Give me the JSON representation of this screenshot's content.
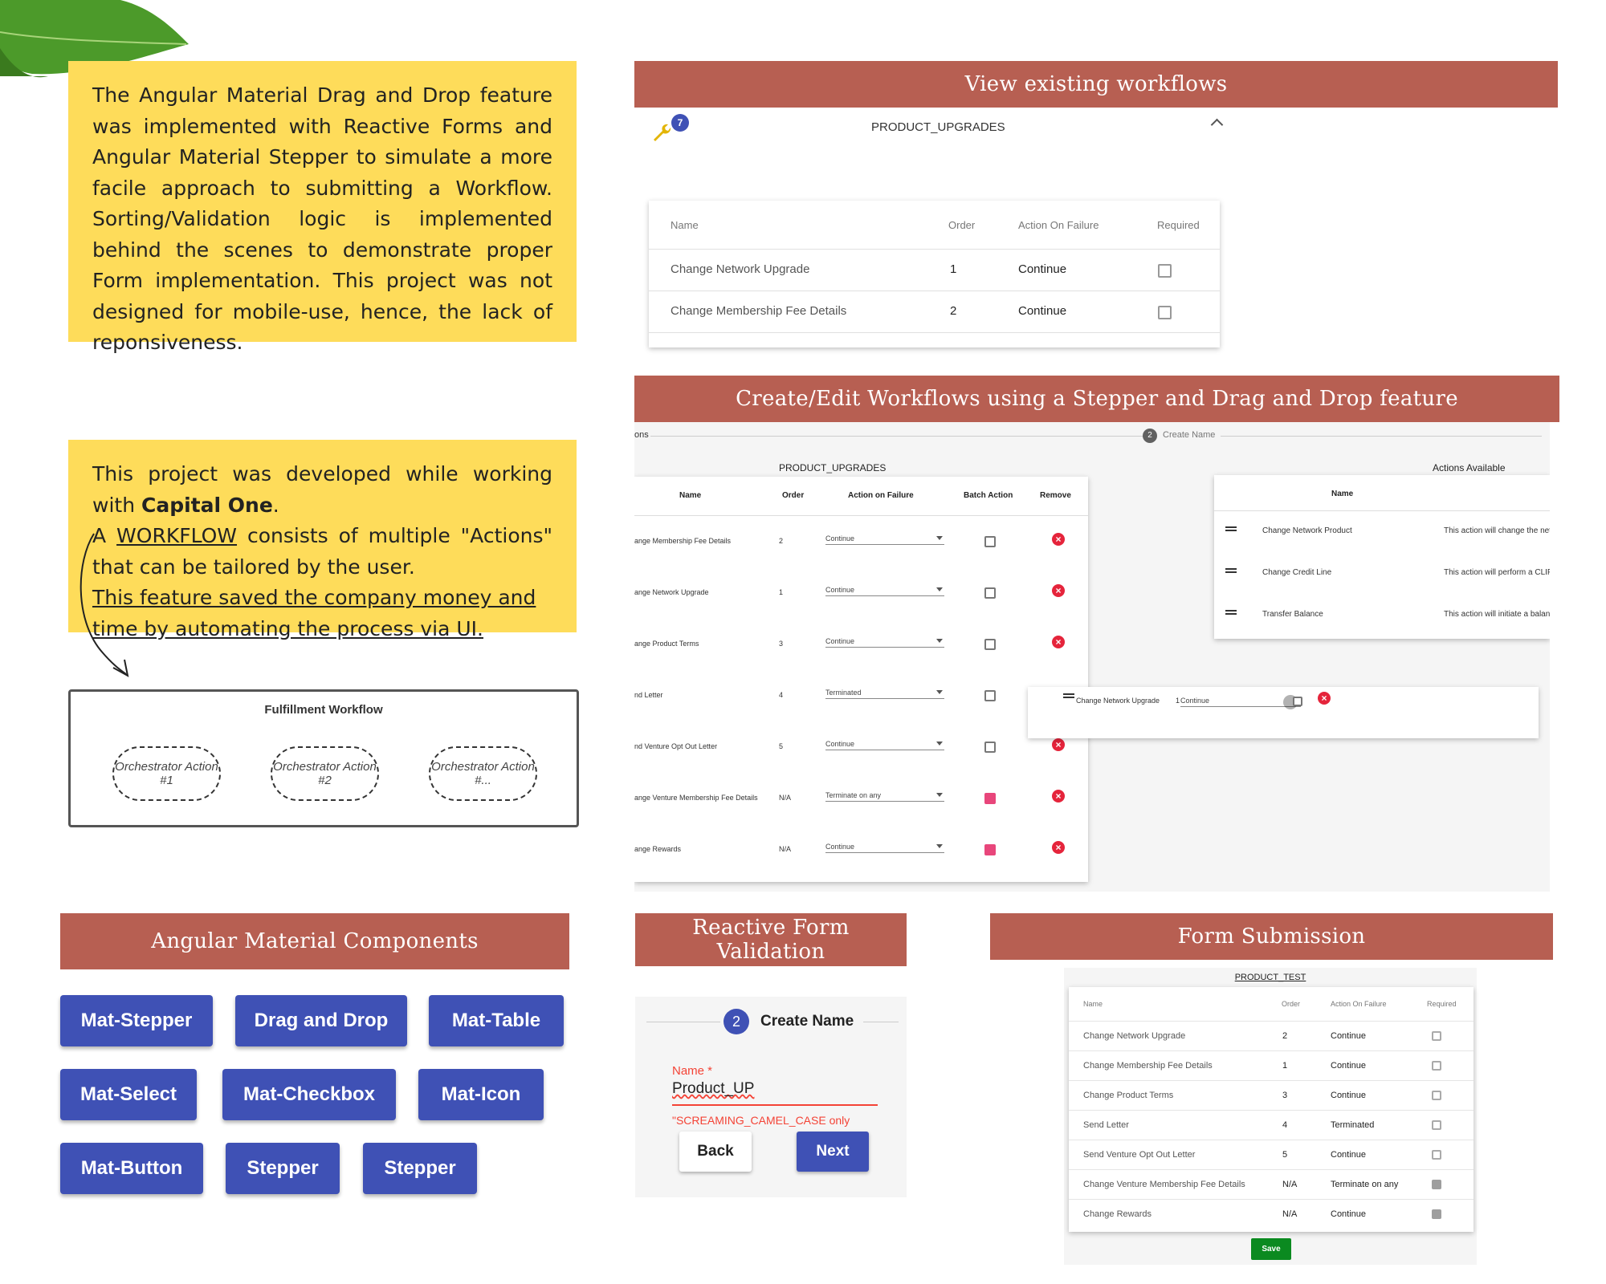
{
  "colors": {
    "note_yellow": "#fedc5a",
    "banner": "#b75f52",
    "material_indigo": "#3f51b5",
    "save_green": "#0b8a20",
    "error_red": "#f44336",
    "checkbox_pink": "#e8467b"
  },
  "notes": {
    "intro": "The Angular Material Drag and Drop feature was implemented with Reactive Forms and Angular Material Stepper to simulate a more facile approach to submitting a Workflow. Sorting/Validation logic is implemented behind the scenes to demonstrate proper Form implementation. This project was not designed for mobile-use, hence, the lack of reponsiveness.",
    "capital_prefix": "This project was developed while working with ",
    "capital_name": "Capital One",
    "capital_suffix": ".",
    "workflow_prefix": "A ",
    "workflow_word": "WORKFLOW",
    "workflow_suffix": " consists of multiple \"Actions\" that can be tailored by the user.",
    "saved": "This feature saved the company money and time by automating the process via UI. "
  },
  "fulfillment": {
    "title": "Fulfillment Workflow",
    "actions": [
      "Orchestrator Action #1",
      "Orchestrator Action #2",
      "Orchestrator Action #..."
    ]
  },
  "banners": {
    "view": "View existing workflows",
    "create": "Create/Edit Workflows using a Stepper and Drag and Drop feature",
    "components": "Angular Material Components",
    "validation": "Reactive Form Validation",
    "submission": "Form Submission"
  },
  "view_panel": {
    "badge": "7",
    "icon": "wrench-icon",
    "title": "PRODUCT_UPGRADES",
    "headers": [
      "Name",
      "Order",
      "Action On Failure",
      "Required"
    ],
    "rows": [
      {
        "name": "Change Network Upgrade",
        "order": "1",
        "action": "Continue"
      },
      {
        "name": "Change Membership Fee Details",
        "order": "2",
        "action": "Continue"
      }
    ]
  },
  "create_panel": {
    "step_fragment": "ons",
    "step_number": "2",
    "step_label": "Create Name",
    "workflow_title": "PRODUCT_UPGRADES",
    "available_title": "Actions Available",
    "headers": [
      "Name",
      "Order",
      "Action on Failure",
      "Batch Action",
      "Remove"
    ],
    "rows": [
      {
        "name": "ange Membership Fee Details",
        "order": "2",
        "action": "Continue",
        "batch": false
      },
      {
        "name": "ange Network Upgrade",
        "order": "1",
        "action": "Continue",
        "batch": false
      },
      {
        "name": "ange Product Terms",
        "order": "3",
        "action": "Continue",
        "batch": false
      },
      {
        "name": "nd Letter",
        "order": "4",
        "action": "Terminated",
        "batch": false
      },
      {
        "name": "nd Venture Opt Out Letter",
        "order": "5",
        "action": "Continue",
        "batch": false
      },
      {
        "name": "ange Venture Membership Fee Details",
        "order": "N/A",
        "action": "Terminate on any",
        "batch": true
      },
      {
        "name": "ange Rewards",
        "order": "N/A",
        "action": "Continue",
        "batch": true
      }
    ],
    "available_header": "Name",
    "available_rows": [
      {
        "name": "Change Network Product",
        "desc": "This action will change the net"
      },
      {
        "name": "Change Credit Line",
        "desc": "This action will perform a CLIP"
      },
      {
        "name": "Transfer Balance",
        "desc": "This action will initiate a balan"
      }
    ],
    "dragging": {
      "name": "Change Network Upgrade",
      "order": "1",
      "action": "Continue"
    }
  },
  "components": [
    "Mat-Stepper",
    "Drag and Drop",
    "Mat-Table",
    "Mat-Select",
    "Mat-Checkbox",
    "Mat-Icon",
    "Mat-Button",
    "Stepper",
    "Stepper"
  ],
  "validation_panel": {
    "step_number": "2",
    "step_label": "Create Name",
    "field_label": "Name *",
    "field_value": "Product_UP",
    "error": "\"SCREAMING_CAMEL_CASE only",
    "back": "Back",
    "next": "Next"
  },
  "submission_panel": {
    "title": "PRODUCT_TEST",
    "headers": [
      "Name",
      "Order",
      "Action On Failure",
      "Required"
    ],
    "rows": [
      {
        "name": "Change Network Upgrade",
        "order": "2",
        "action": "Continue",
        "required": false
      },
      {
        "name": "Change Membership Fee Details",
        "order": "1",
        "action": "Continue",
        "required": false
      },
      {
        "name": "Change Product Terms",
        "order": "3",
        "action": "Continue",
        "required": false
      },
      {
        "name": "Send Letter",
        "order": "4",
        "action": "Terminated",
        "required": false
      },
      {
        "name": "Send Venture Opt Out Letter",
        "order": "5",
        "action": "Continue",
        "required": false
      },
      {
        "name": "Change Venture Membership Fee Details",
        "order": "N/A",
        "action": "Terminate on any",
        "required": true
      },
      {
        "name": "Change Rewards",
        "order": "N/A",
        "action": "Continue",
        "required": true
      }
    ],
    "save": "Save"
  }
}
